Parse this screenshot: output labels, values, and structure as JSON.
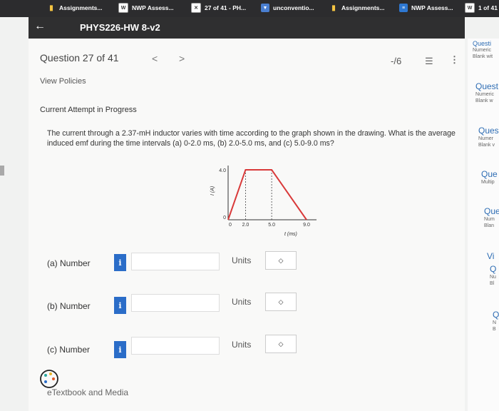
{
  "tabs": [
    {
      "label": "Assignments...",
      "icon": "bar-chart-icon"
    },
    {
      "label": "NWP Assess...",
      "icon": "w-icon"
    },
    {
      "label": "27 of 41 - PH...",
      "icon": "x-box-icon"
    },
    {
      "label": "unconventio...",
      "icon": "funnel-icon"
    },
    {
      "label": "Assignments...",
      "icon": "bar-chart-icon"
    },
    {
      "label": "NWP Assess...",
      "icon": "nwp-icon"
    },
    {
      "label": "1 of 41",
      "icon": "w-icon"
    }
  ],
  "header": {
    "course": "PHYS226-HW 8-v2"
  },
  "question": {
    "title": "Question 27 of 41",
    "score": "-/6",
    "view_policies": "View Policies",
    "attempt": "Current Attempt in Progress",
    "text": "The current through a 2.37-mH inductor varies with time according to the graph shown in the drawing. What is the average induced emf during the time intervals (a) 0-2.0 ms, (b) 2.0-5.0 ms, and (c) 5.0-9.0 ms?"
  },
  "chart_data": {
    "type": "line",
    "x": [
      0,
      2.0,
      5.0,
      9.0
    ],
    "y": [
      0,
      4.0,
      4.0,
      0
    ],
    "xlabel": "t (ms)",
    "ylabel": "I (A)",
    "xticks": [
      "0",
      "2.0",
      "5.0",
      "9.0"
    ],
    "yticks": [
      "0",
      "4.0"
    ],
    "xlim": [
      0,
      9.0
    ],
    "ylim": [
      0,
      4.0
    ]
  },
  "answers": [
    {
      "label": "(a)  Number",
      "info": "i",
      "value": "",
      "units_label": "Units",
      "units_value": ""
    },
    {
      "label": "(b)  Number",
      "info": "i",
      "value": "",
      "units_label": "Units",
      "units_value": ""
    },
    {
      "label": "(c)  Number",
      "info": "i",
      "value": "",
      "units_label": "Units",
      "units_value": ""
    }
  ],
  "etextbook": "eTextbook and Media",
  "sidebar": [
    {
      "title": "Questi",
      "sub": [
        "Numeric",
        "Blank wit"
      ]
    },
    {
      "title": "Quest",
      "sub": [
        "Numeric",
        "Blank w"
      ]
    },
    {
      "title": "Ques",
      "sub": [
        "Numer",
        "Blank v"
      ]
    },
    {
      "title": "Que",
      "sub": [
        "Multip"
      ]
    },
    {
      "title": "Que",
      "sub": [
        "Num",
        "Blan"
      ]
    },
    {
      "title": "Vi",
      "sub": []
    },
    {
      "title": "Q",
      "sub": [
        "Nu",
        "Bl"
      ]
    },
    {
      "title": "Q",
      "sub": [
        "N",
        "B"
      ]
    }
  ],
  "colors": {
    "accent": "#2b6dc8",
    "header": "#2f2f30",
    "tabbar": "#2c2c2e"
  }
}
